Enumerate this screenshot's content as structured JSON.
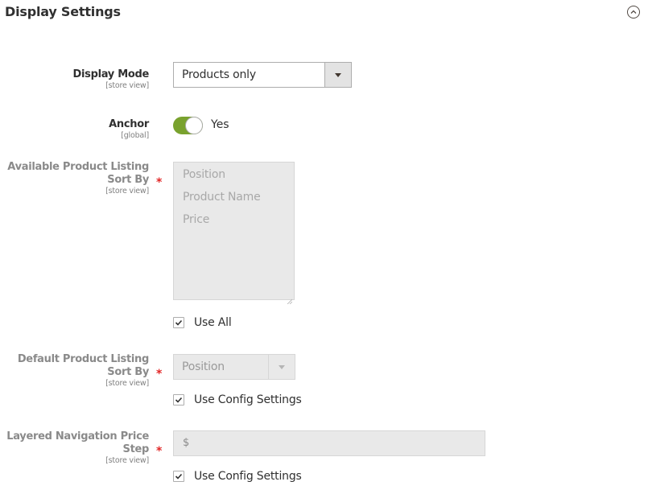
{
  "section": {
    "title": "Display Settings",
    "collapse_icon": "chevron-up-circle-icon"
  },
  "fields": {
    "display_mode": {
      "label": "Display Mode",
      "scope": "[store view]",
      "value": "Products only"
    },
    "anchor": {
      "label": "Anchor",
      "scope": "[global]",
      "value": "Yes",
      "enabled": true,
      "accent": "#79a22e"
    },
    "available_sort_by": {
      "label_line1": "Available Product Listing",
      "label_line2": "Sort By",
      "scope": "[store view]",
      "required": "*",
      "options": [
        "Position",
        "Product Name",
        "Price"
      ],
      "use_all_label": "Use All",
      "use_all_checked": true
    },
    "default_sort_by": {
      "label_line1": "Default Product Listing",
      "label_line2": "Sort By",
      "scope": "[store view]",
      "required": "*",
      "value": "Position",
      "use_config_label": "Use Config Settings",
      "use_config_checked": true
    },
    "price_step": {
      "label_line1": "Layered Navigation Price",
      "label_line2": "Step",
      "scope": "[store view]",
      "required": "*",
      "addon": "$",
      "value": "",
      "use_config_label": "Use Config Settings",
      "use_config_checked": true
    }
  }
}
